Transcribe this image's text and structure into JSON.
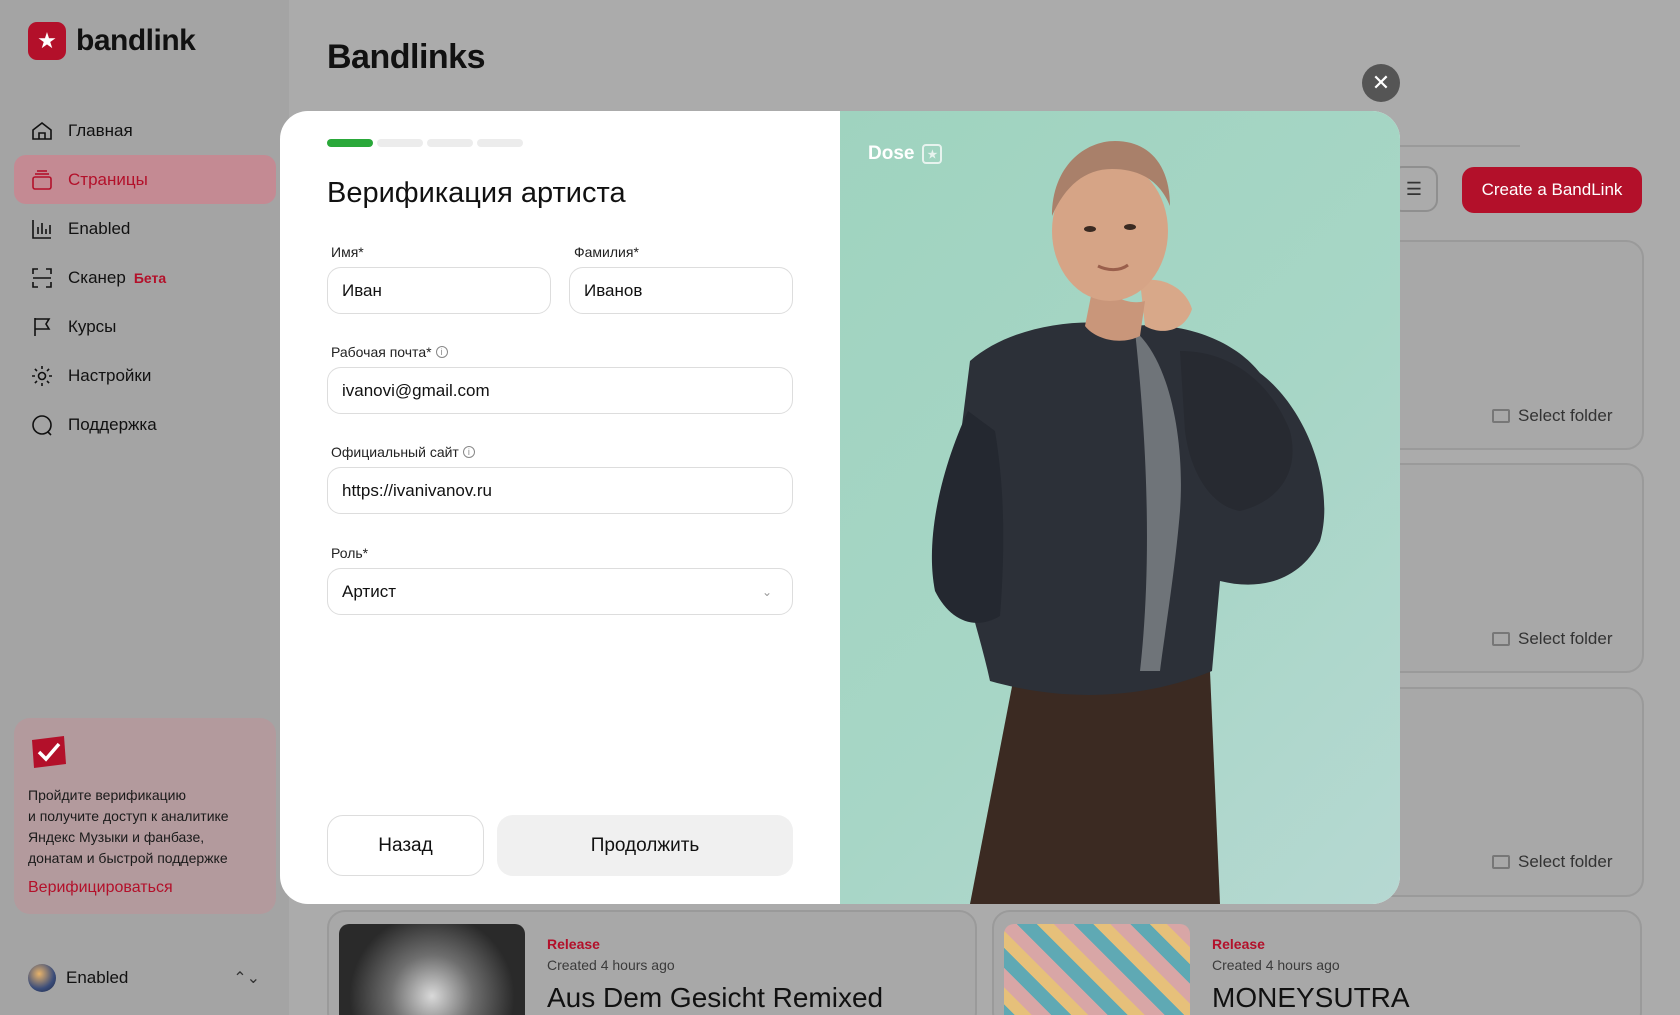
{
  "brand": {
    "name": "bandlink",
    "logo_icon": "star-badge-icon",
    "accent": "#b3102a"
  },
  "sidebar": {
    "items": [
      {
        "label": "Главная",
        "icon": "home-icon"
      },
      {
        "label": "Страницы",
        "icon": "pages-icon",
        "active": true
      },
      {
        "label": "Enabled",
        "icon": "stats-icon"
      },
      {
        "label": "Сканер",
        "icon": "scanner-icon",
        "badge": "Бета"
      },
      {
        "label": "Курсы",
        "icon": "flag-icon"
      },
      {
        "label": "Настройки",
        "icon": "gear-icon"
      },
      {
        "label": "Поддержка",
        "icon": "chat-icon"
      }
    ],
    "verify_card": {
      "text_lines": [
        "Пройдите верификацию",
        "и получите доступ к аналитике",
        "Яндекс Музыки и фанбазе,",
        "донатам и быстрой поддержке"
      ],
      "link": "Верифицироваться"
    },
    "account": {
      "name": "Enabled"
    }
  },
  "main": {
    "title": "Bandlinks",
    "create_button": "Create a BandLink",
    "select_folder": "Select folder",
    "releases": [
      {
        "tag": "Release",
        "created": "Created 4 hours ago",
        "name": "Aus Dem Gesicht Remixed"
      },
      {
        "tag": "Release",
        "created": "Created 4 hours ago",
        "name": "MONEYSUTRA"
      }
    ]
  },
  "modal": {
    "progress": {
      "current_step": 1,
      "total_steps": 4
    },
    "title": "Верификация артиста",
    "fields": {
      "first_name": {
        "label": "Имя*",
        "value": "Иван"
      },
      "last_name": {
        "label": "Фамилия*",
        "value": "Иванов"
      },
      "email": {
        "label": "Рабочая почта*",
        "value": "ivanovi@gmail.com"
      },
      "website": {
        "label": "Официальный сайт",
        "value": "https://ivanivanov.ru"
      },
      "role": {
        "label": "Роль*",
        "value": "Артист"
      }
    },
    "back_button": "Назад",
    "continue_button": "Продолжить",
    "photo": {
      "brand": "Dose"
    },
    "success_color": "#2aa83a"
  }
}
